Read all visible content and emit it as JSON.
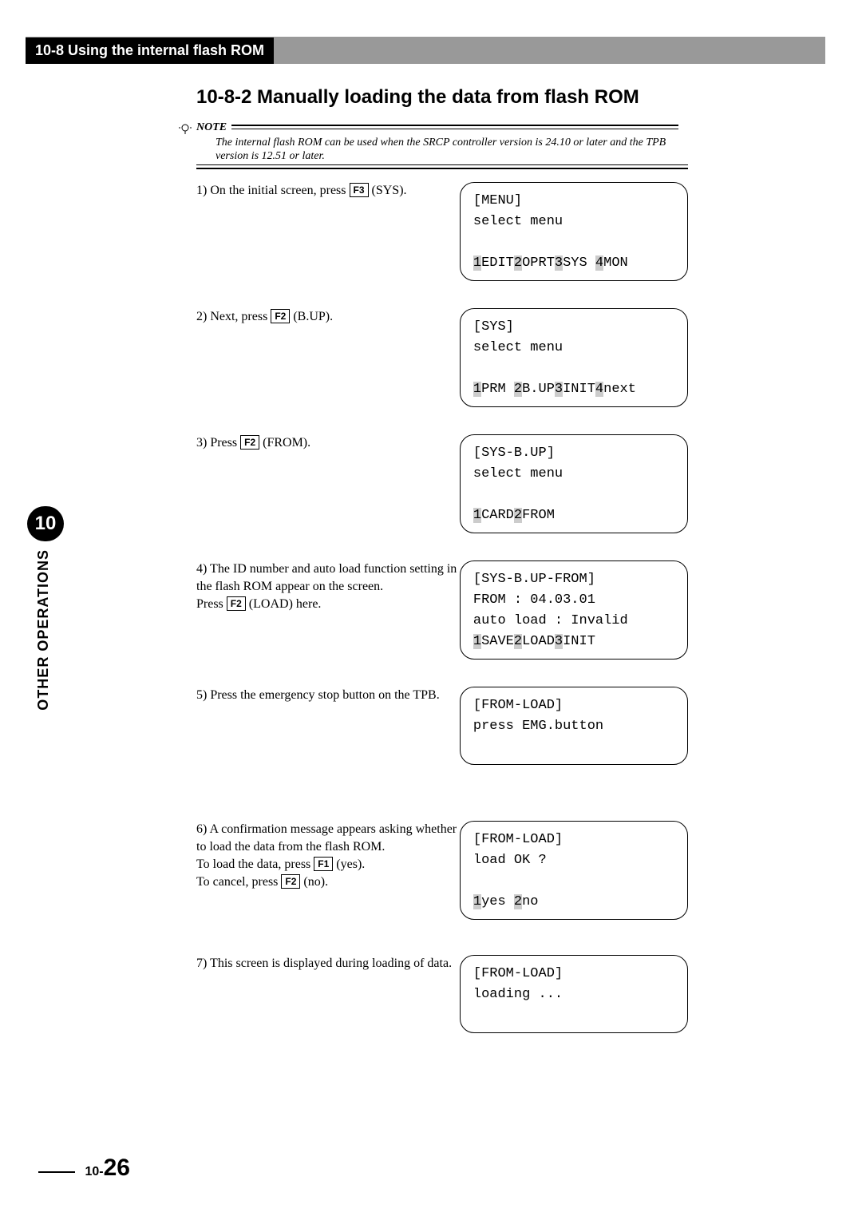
{
  "header": {
    "title": "10-8 Using the internal flash ROM"
  },
  "section": {
    "heading": "10-8-2 Manually loading the data from flash ROM"
  },
  "note": {
    "label": "NOTE",
    "body": "The internal flash ROM can be used when the SRCP controller version is 24.10 or later and the TPB version is 12.51 or later."
  },
  "keys": {
    "f1": "F1",
    "f2": "F2",
    "f3": "F3"
  },
  "steps": [
    {
      "pre": "1)  On the initial screen, press ",
      "key": "f3",
      "post": " (SYS).",
      "lcd": {
        "l1": "[MENU]",
        "l2": "select menu",
        "l3": "",
        "opts": [
          {
            "n": "1",
            "t": "EDIT"
          },
          {
            "n": "2",
            "t": "OPRT"
          },
          {
            "n": "3",
            "t": "SYS "
          },
          {
            "n": "4",
            "t": "MON"
          }
        ]
      }
    },
    {
      "pre": "2)  Next, press ",
      "key": "f2",
      "post": " (B.UP).",
      "lcd": {
        "l1": "[SYS]",
        "l2": "select menu",
        "l3": "",
        "opts": [
          {
            "n": "1",
            "t": "PRM "
          },
          {
            "n": "2",
            "t": "B.UP"
          },
          {
            "n": "3",
            "t": "INIT"
          },
          {
            "n": "4",
            "t": "next"
          }
        ]
      }
    },
    {
      "pre": "3)  Press ",
      "key": "f2",
      "post": " (FROM).",
      "lcd": {
        "l1": "[SYS-B.UP]",
        "l2": "select menu",
        "l3": "",
        "opts": [
          {
            "n": "1",
            "t": "CARD"
          },
          {
            "n": "2",
            "t": "FROM"
          }
        ]
      }
    },
    {
      "para1": "4)  The ID number and auto load function setting in the flash ROM appear on the screen.",
      "pre": "Press ",
      "key": "f2",
      "post": " (LOAD) here.",
      "lcd": {
        "l1": "[SYS-B.UP-FROM]",
        "l2": "FROM : 04.03.01",
        "l3": "auto load : Invalid",
        "opts": [
          {
            "n": "1",
            "t": "SAVE"
          },
          {
            "n": "2",
            "t": "LOAD"
          },
          {
            "n": "3",
            "t": "INIT"
          }
        ]
      }
    },
    {
      "plain": "5)  Press the emergency stop button on the TPB.",
      "lcd": {
        "l1": "[FROM-LOAD]",
        "l2": "press EMG.button",
        "l3": "",
        "opts": []
      }
    },
    {
      "para1": "6)  A confirmation message appears asking whether to load the data from the flash ROM.",
      "line2_pre": "To load the data, press ",
      "line2_key": "f1",
      "line2_post": " (yes).",
      "line3_pre": "To cancel, press ",
      "line3_key": "f2",
      "line3_post": " (no).",
      "lcd": {
        "l1": "[FROM-LOAD]",
        "l2": "load OK ?",
        "l3": "",
        "opts": [
          {
            "n": "1",
            "t": "yes "
          },
          {
            "n": "2",
            "t": "no"
          }
        ]
      }
    },
    {
      "plain": "7)  This screen is displayed during loading of data.",
      "lcd": {
        "l1": "[FROM-LOAD]",
        "l2": "loading ...",
        "l3": "",
        "opts": []
      }
    }
  ],
  "side": {
    "chapter": "10",
    "label": "OTHER OPERATIONS"
  },
  "footer": {
    "prefix": "10-",
    "page": "26"
  }
}
